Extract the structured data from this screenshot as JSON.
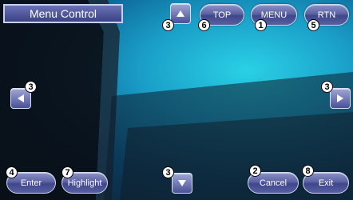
{
  "title": "Menu Control",
  "buttons": {
    "top": "TOP",
    "menu": "MENU",
    "rtn": "RTN",
    "enter": "Enter",
    "highlight": "Highlight",
    "cancel": "Cancel",
    "exit": "Exit"
  },
  "badges": {
    "menu": "1",
    "cancel": "2",
    "up": "3",
    "left": "3",
    "right": "3",
    "down": "3",
    "enter": "4",
    "rtn": "5",
    "top": "6",
    "highlight": "7",
    "exit": "8"
  },
  "icons": {
    "up": "arrow-up-icon",
    "down": "arrow-down-icon",
    "left": "arrow-left-icon",
    "right": "arrow-right-icon"
  }
}
